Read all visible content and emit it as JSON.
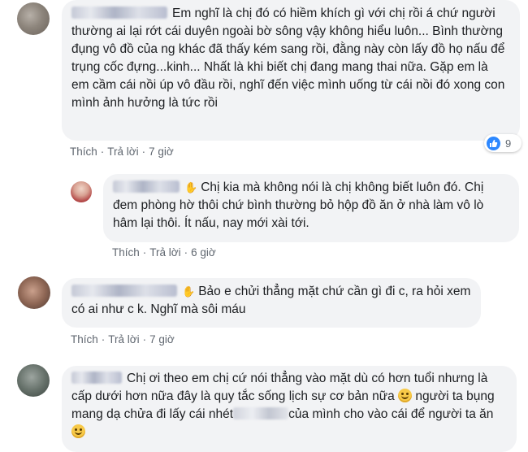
{
  "comments": [
    {
      "text": "Em nghĩ là chị đó có hiềm khích gì với chị rồi á chứ người thường ai lại rớt cái duyên ngoài bờ sông vậy không hiểu luôn... Bình thường đụng vô đồ của ng khác đã thấy kém sang rồi, đằng này còn lấy đồ họ nấu để trụng cốc đựng...kinh... Nhất là khi biết chị đang mang thai nữa. Gặp em là em cầm cái nồi úp vô đầu rồi, nghĩ đến việc mình uống từ cái nồi đó xong con mình ảnh hưởng là tức rồi",
      "like": "Thích",
      "reply": "Trả lời",
      "time": "7 giờ",
      "reaction_count": "9"
    },
    {
      "text": "Chị kia mà không nói là chị không biết luôn đó. Chị đem phòng hờ thôi chứ bình thường bỏ hộp đồ ăn ở nhà làm vô lò hâm lại thôi. Ít nấu, nay mới xài tới.",
      "like": "Thích",
      "reply": "Trả lời",
      "time": "6 giờ"
    },
    {
      "text": "Bảo e chửi thẳng mặt chứ cần gì đi c, ra hỏi xem có ai như c k. Nghĩ mà sôi máu",
      "like": "Thích",
      "reply": "Trả lời",
      "time": "7 giờ"
    },
    {
      "text_1": "Chị ơi theo em chị cứ nói thẳng vào mặt dù có hơn tuổi nhưng là cấp dưới hơn nữa đây là quy tắc sống lịch sự cơ bản nữa",
      "text_2": "người ta bụng mang dạ chửa đi lấy cái nhét",
      "text_3": "của mình cho vào cái để người ta ăn"
    }
  ],
  "icons": {
    "like_reaction": "thumbs-up-icon",
    "hand": "waving-hand-icon",
    "smile": "smile-emoji-icon"
  },
  "colors": {
    "bubble": "#f2f3f5",
    "action_text": "#606770",
    "like_blue": "#2d88ff"
  }
}
